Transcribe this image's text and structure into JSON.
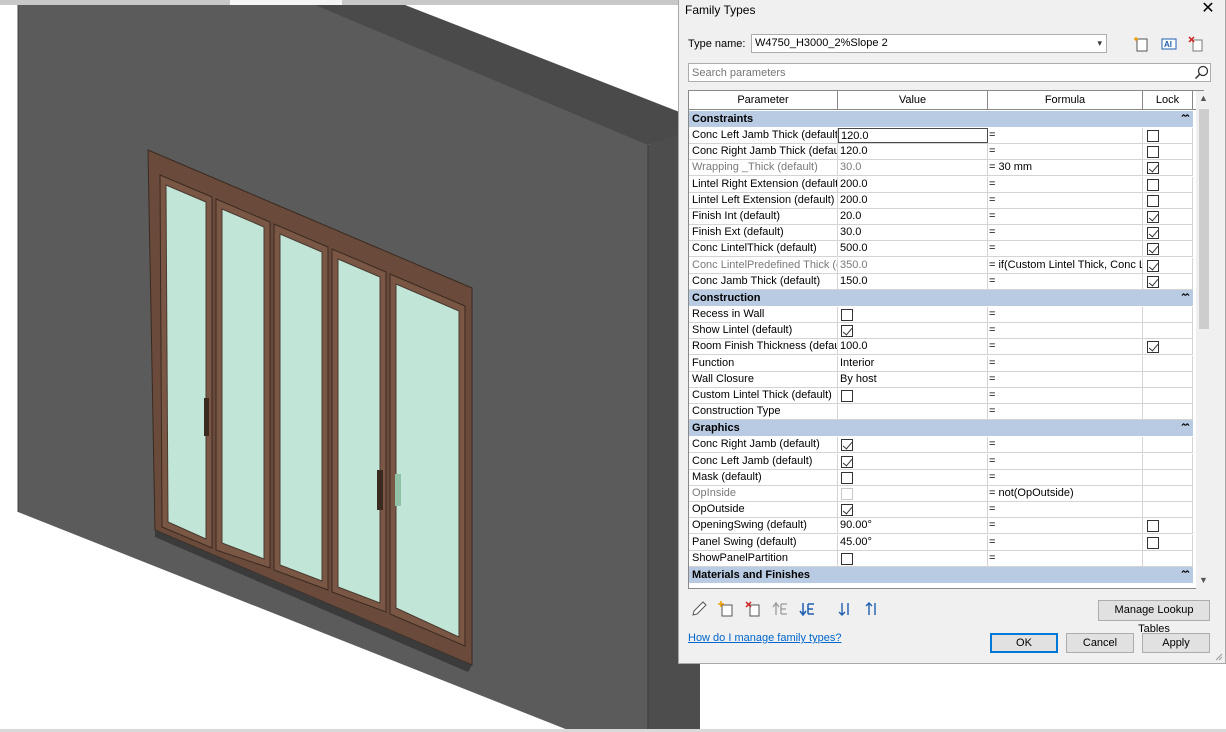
{
  "dialog": {
    "title": "Family Types",
    "type_name_label": "Type name:",
    "type_name_value": "W4750_H3000_2%Slope 2",
    "search_placeholder": "Search parameters",
    "columns": [
      "Parameter",
      "Value",
      "Formula",
      "Lock"
    ],
    "groups": [
      {
        "name": "Constraints",
        "toggle": "⌃",
        "rows": [
          {
            "param": "Conc Left Jamb Thick (default)",
            "value": "120.0",
            "value_type": "text",
            "formula": "=",
            "lock": "off",
            "active": true
          },
          {
            "param": "Conc Right Jamb Thick (default)",
            "value": "120.0",
            "value_type": "text",
            "formula": "=",
            "lock": "off"
          },
          {
            "param": "Wrapping _Thick (default)",
            "value": "30.0",
            "value_type": "text",
            "formula": "= 30 mm",
            "lock": "on",
            "dim": true
          },
          {
            "param": "Lintel Right Extension (default)",
            "value": "200.0",
            "value_type": "text",
            "formula": "=",
            "lock": "off"
          },
          {
            "param": "Lintel Left Extension (default)",
            "value": "200.0",
            "value_type": "text",
            "formula": "=",
            "lock": "off"
          },
          {
            "param": "Finish Int (default)",
            "value": "20.0",
            "value_type": "text",
            "formula": "=",
            "lock": "on"
          },
          {
            "param": "Finish Ext (default)",
            "value": "30.0",
            "value_type": "text",
            "formula": "=",
            "lock": "on"
          },
          {
            "param": "Conc LintelThick (default)",
            "value": "500.0",
            "value_type": "text",
            "formula": "=",
            "lock": "on"
          },
          {
            "param": "Conc LintelPredefined Thick (d",
            "value": "350.0",
            "value_type": "text",
            "formula": "= if(Custom Lintel Thick, Conc L",
            "lock": "on",
            "dim": true
          },
          {
            "param": "Conc Jamb Thick (default)",
            "value": "150.0",
            "value_type": "text",
            "formula": "=",
            "lock": "on"
          }
        ]
      },
      {
        "name": "Construction",
        "toggle": "⌃",
        "rows": [
          {
            "param": "Recess in Wall",
            "value": "off",
            "value_type": "check",
            "formula": "=",
            "lock": "none"
          },
          {
            "param": "Show Lintel (default)",
            "value": "on",
            "value_type": "check",
            "formula": "=",
            "lock": "none"
          },
          {
            "param": "Room Finish Thickness (defaul",
            "value": "100.0",
            "value_type": "text",
            "formula": "=",
            "lock": "on"
          },
          {
            "param": "Function",
            "value": "Interior",
            "value_type": "text",
            "formula": "=",
            "lock": "none"
          },
          {
            "param": "Wall Closure",
            "value": "By host",
            "value_type": "text",
            "formula": "=",
            "lock": "none"
          },
          {
            "param": "Custom Lintel Thick (default)",
            "value": "off",
            "value_type": "check",
            "formula": "=",
            "lock": "none"
          },
          {
            "param": "Construction Type",
            "value": "",
            "value_type": "text",
            "formula": "=",
            "lock": "none"
          }
        ]
      },
      {
        "name": "Graphics",
        "toggle": "⌃",
        "rows": [
          {
            "param": "Conc Right Jamb (default)",
            "value": "on",
            "value_type": "check",
            "formula": "=",
            "lock": "none"
          },
          {
            "param": "Conc Left Jamb (default)",
            "value": "on",
            "value_type": "check",
            "formula": "=",
            "lock": "none"
          },
          {
            "param": "Mask (default)",
            "value": "off",
            "value_type": "check",
            "formula": "=",
            "lock": "none"
          },
          {
            "param": "OpInside",
            "value": "dis",
            "value_type": "check",
            "formula": "= not(OpOutside)",
            "lock": "none",
            "dim": true
          },
          {
            "param": "OpOutside",
            "value": "on",
            "value_type": "check",
            "formula": "=",
            "lock": "none"
          },
          {
            "param": "OpeningSwing (default)",
            "value": "90.00°",
            "value_type": "text",
            "formula": "=",
            "lock": "off"
          },
          {
            "param": "Panel Swing (default)",
            "value": "45.00°",
            "value_type": "text",
            "formula": "=",
            "lock": "off"
          },
          {
            "param": "ShowPanelPartition",
            "value": "off",
            "value_type": "check",
            "formula": "=",
            "lock": "none"
          }
        ]
      },
      {
        "name": "Materials and Finishes",
        "toggle": "⌃",
        "rows": []
      }
    ],
    "manage_lookup_label": "Manage Lookup Tables",
    "help_link": "How do I manage family types?",
    "ok_label": "OK",
    "cancel_label": "Cancel",
    "apply_label": "Apply"
  },
  "icons": {
    "toolbar_top": [
      "new-type-icon",
      "rename-type-icon",
      "delete-type-icon"
    ],
    "toolbar_bottom": [
      "edit-parameter-icon",
      "new-parameter-icon",
      "delete-parameter-icon",
      "move-up-icon",
      "move-down-icon",
      "sort-ascending-icon",
      "sort-descending-icon"
    ]
  },
  "colors": {
    "group_header": "#b9cbe2",
    "link": "#0066cc",
    "default_button_border": "#0078d7",
    "wall": "#5a5a5a",
    "frame": "#6b4a3a",
    "glass": "#bfe3d6"
  }
}
